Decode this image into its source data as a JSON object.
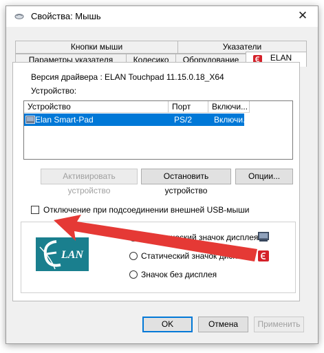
{
  "window": {
    "title": "Свойства: Мышь",
    "close_glyph": "✕"
  },
  "tabs": {
    "row1": [
      "Кнопки мыши",
      "Указатели"
    ],
    "row2": [
      "Параметры указателя",
      "Колесико",
      "Оборудование",
      "ELAN"
    ],
    "active": "ELAN"
  },
  "elan": {
    "driver_label": "Версия драйвера :",
    "driver_value": "ELAN Touchpad 11.15.0.18_X64",
    "device_label": "Устройство:",
    "columns": [
      "Устройство",
      "Порт",
      "Включи..."
    ],
    "rows": [
      {
        "device": "Elan Smart-Pad",
        "port": "PS/2",
        "enabled": "Включи..."
      }
    ],
    "buttons": {
      "activate": "Активировать устройство",
      "stop": "Остановить устройство",
      "options": "Опции..."
    },
    "usb_checkbox": "Отключение при подсоединении внешней USB-мыши",
    "usb_checked": false,
    "logo_text": "LAN",
    "radios": [
      {
        "label": "Динамический значок дисплея",
        "selected": true,
        "icon": "touchpad-icon"
      },
      {
        "label": "Статический значок дисплея",
        "selected": false,
        "icon": "elan-red-icon"
      },
      {
        "label": "Значок без дисплея",
        "selected": false,
        "icon": ""
      }
    ]
  },
  "footer": {
    "ok": "OK",
    "cancel": "Отмена",
    "apply": "Применить"
  },
  "colors": {
    "selection": "#0078d7",
    "arrow": "#e53935",
    "logo_teal": "#1a7f8e",
    "elan_red": "#d4212a"
  }
}
